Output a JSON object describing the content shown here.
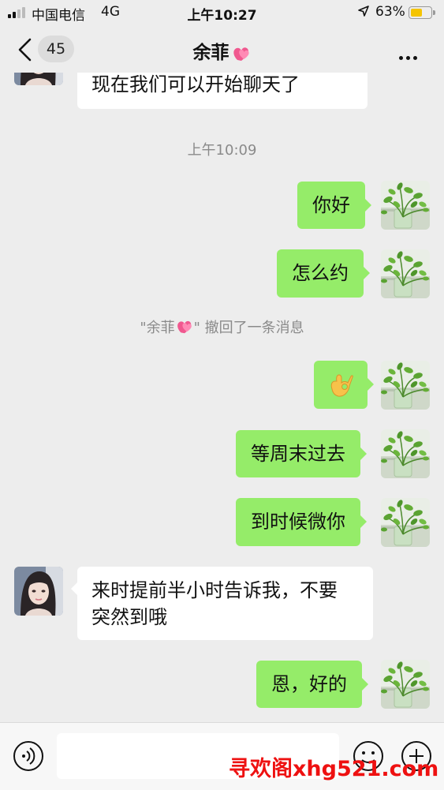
{
  "status_bar": {
    "carrier": "中国电信",
    "network": "4G",
    "time": "上午10:27",
    "battery_percent": "63%",
    "battery_level": 0.63,
    "battery_color": "#f5c400"
  },
  "nav": {
    "unread_count": "45",
    "contact_name": "余菲"
  },
  "messages": {
    "m0_text": "现在我们可以开始聊天了",
    "timestamp": "上午10:09",
    "m1_text": "你好",
    "m2_text": "怎么约",
    "recall_pre": "\"余菲",
    "recall_post": "\" 撤回了一条消息",
    "m3_emoji": "ok-hand-emoji",
    "m4_text": "等周末过去",
    "m5_text": "到时候微你",
    "m6_line1": "来时提前半小时告诉我，不要",
    "m6_line2": "突然到哦",
    "m7_text": "恩，好的"
  },
  "input_bar": {
    "left_icon": "voice-icon",
    "emoji_icon": "emoji-face-icon",
    "plus_icon": "plus-circle-icon",
    "watermark": "寻欢阁xhg521.com"
  },
  "colors": {
    "sent_bubble": "#95ec69",
    "received_bubble": "#ffffff",
    "background": "#ededed",
    "watermark": "#ee1111"
  }
}
